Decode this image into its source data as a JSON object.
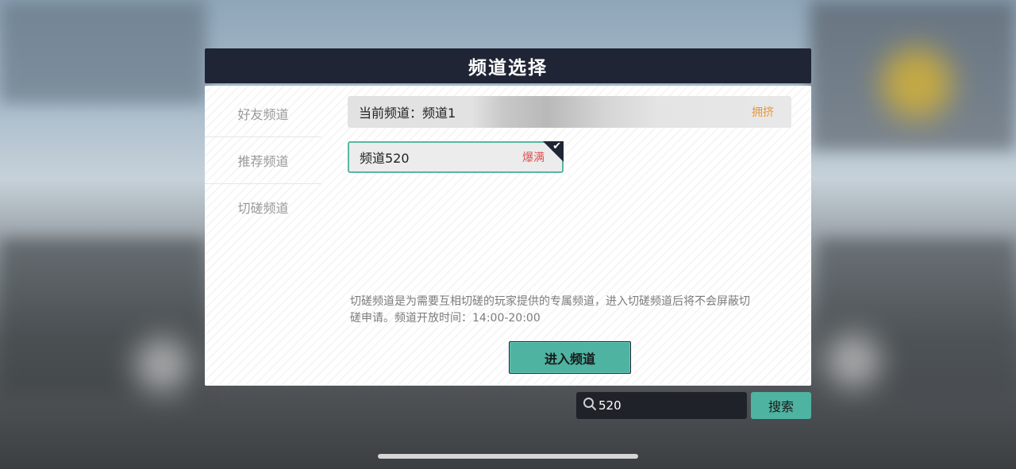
{
  "dialog": {
    "title": "频道选择"
  },
  "sidebar": {
    "items": [
      {
        "label": "好友频道"
      },
      {
        "label": "推荐频道"
      },
      {
        "label": "切磋频道"
      }
    ]
  },
  "current_channel": {
    "label": "当前频道：频道1",
    "status": "拥挤",
    "status_color": "#e8983a"
  },
  "channels": [
    {
      "name": "频道520",
      "status": "爆满",
      "status_color": "#e05050",
      "selected": true
    }
  ],
  "description": {
    "line1": "切磋频道是为需要互相切磋的玩家提供的专属频道，进入切磋频道后将不会屏蔽切",
    "line2": "磋申请。频道开放时间：14:00-20:00"
  },
  "enter_button": {
    "label": "进入频道"
  },
  "search": {
    "value": "520",
    "button_label": "搜索",
    "icon": "search-icon",
    "clear_icon": "close-icon"
  },
  "colors": {
    "accent": "#4fb3a1",
    "header_bg": "#1f2535",
    "selected_border": "#5ab6a3"
  }
}
